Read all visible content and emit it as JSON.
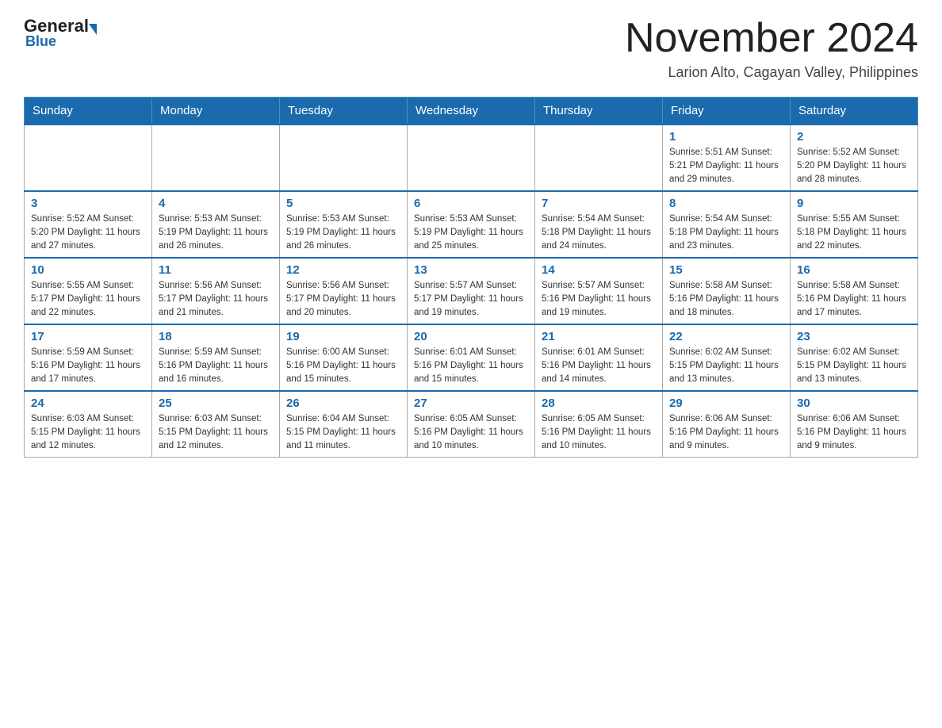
{
  "header": {
    "logo_general": "General",
    "logo_blue": "Blue",
    "title": "November 2024",
    "subtitle": "Larion Alto, Cagayan Valley, Philippines"
  },
  "days_of_week": [
    "Sunday",
    "Monday",
    "Tuesday",
    "Wednesday",
    "Thursday",
    "Friday",
    "Saturday"
  ],
  "weeks": [
    [
      {
        "day": "",
        "info": ""
      },
      {
        "day": "",
        "info": ""
      },
      {
        "day": "",
        "info": ""
      },
      {
        "day": "",
        "info": ""
      },
      {
        "day": "",
        "info": ""
      },
      {
        "day": "1",
        "info": "Sunrise: 5:51 AM\nSunset: 5:21 PM\nDaylight: 11 hours and 29 minutes."
      },
      {
        "day": "2",
        "info": "Sunrise: 5:52 AM\nSunset: 5:20 PM\nDaylight: 11 hours and 28 minutes."
      }
    ],
    [
      {
        "day": "3",
        "info": "Sunrise: 5:52 AM\nSunset: 5:20 PM\nDaylight: 11 hours and 27 minutes."
      },
      {
        "day": "4",
        "info": "Sunrise: 5:53 AM\nSunset: 5:19 PM\nDaylight: 11 hours and 26 minutes."
      },
      {
        "day": "5",
        "info": "Sunrise: 5:53 AM\nSunset: 5:19 PM\nDaylight: 11 hours and 26 minutes."
      },
      {
        "day": "6",
        "info": "Sunrise: 5:53 AM\nSunset: 5:19 PM\nDaylight: 11 hours and 25 minutes."
      },
      {
        "day": "7",
        "info": "Sunrise: 5:54 AM\nSunset: 5:18 PM\nDaylight: 11 hours and 24 minutes."
      },
      {
        "day": "8",
        "info": "Sunrise: 5:54 AM\nSunset: 5:18 PM\nDaylight: 11 hours and 23 minutes."
      },
      {
        "day": "9",
        "info": "Sunrise: 5:55 AM\nSunset: 5:18 PM\nDaylight: 11 hours and 22 minutes."
      }
    ],
    [
      {
        "day": "10",
        "info": "Sunrise: 5:55 AM\nSunset: 5:17 PM\nDaylight: 11 hours and 22 minutes."
      },
      {
        "day": "11",
        "info": "Sunrise: 5:56 AM\nSunset: 5:17 PM\nDaylight: 11 hours and 21 minutes."
      },
      {
        "day": "12",
        "info": "Sunrise: 5:56 AM\nSunset: 5:17 PM\nDaylight: 11 hours and 20 minutes."
      },
      {
        "day": "13",
        "info": "Sunrise: 5:57 AM\nSunset: 5:17 PM\nDaylight: 11 hours and 19 minutes."
      },
      {
        "day": "14",
        "info": "Sunrise: 5:57 AM\nSunset: 5:16 PM\nDaylight: 11 hours and 19 minutes."
      },
      {
        "day": "15",
        "info": "Sunrise: 5:58 AM\nSunset: 5:16 PM\nDaylight: 11 hours and 18 minutes."
      },
      {
        "day": "16",
        "info": "Sunrise: 5:58 AM\nSunset: 5:16 PM\nDaylight: 11 hours and 17 minutes."
      }
    ],
    [
      {
        "day": "17",
        "info": "Sunrise: 5:59 AM\nSunset: 5:16 PM\nDaylight: 11 hours and 17 minutes."
      },
      {
        "day": "18",
        "info": "Sunrise: 5:59 AM\nSunset: 5:16 PM\nDaylight: 11 hours and 16 minutes."
      },
      {
        "day": "19",
        "info": "Sunrise: 6:00 AM\nSunset: 5:16 PM\nDaylight: 11 hours and 15 minutes."
      },
      {
        "day": "20",
        "info": "Sunrise: 6:01 AM\nSunset: 5:16 PM\nDaylight: 11 hours and 15 minutes."
      },
      {
        "day": "21",
        "info": "Sunrise: 6:01 AM\nSunset: 5:16 PM\nDaylight: 11 hours and 14 minutes."
      },
      {
        "day": "22",
        "info": "Sunrise: 6:02 AM\nSunset: 5:15 PM\nDaylight: 11 hours and 13 minutes."
      },
      {
        "day": "23",
        "info": "Sunrise: 6:02 AM\nSunset: 5:15 PM\nDaylight: 11 hours and 13 minutes."
      }
    ],
    [
      {
        "day": "24",
        "info": "Sunrise: 6:03 AM\nSunset: 5:15 PM\nDaylight: 11 hours and 12 minutes."
      },
      {
        "day": "25",
        "info": "Sunrise: 6:03 AM\nSunset: 5:15 PM\nDaylight: 11 hours and 12 minutes."
      },
      {
        "day": "26",
        "info": "Sunrise: 6:04 AM\nSunset: 5:15 PM\nDaylight: 11 hours and 11 minutes."
      },
      {
        "day": "27",
        "info": "Sunrise: 6:05 AM\nSunset: 5:16 PM\nDaylight: 11 hours and 10 minutes."
      },
      {
        "day": "28",
        "info": "Sunrise: 6:05 AM\nSunset: 5:16 PM\nDaylight: 11 hours and 10 minutes."
      },
      {
        "day": "29",
        "info": "Sunrise: 6:06 AM\nSunset: 5:16 PM\nDaylight: 11 hours and 9 minutes."
      },
      {
        "day": "30",
        "info": "Sunrise: 6:06 AM\nSunset: 5:16 PM\nDaylight: 11 hours and 9 minutes."
      }
    ]
  ]
}
